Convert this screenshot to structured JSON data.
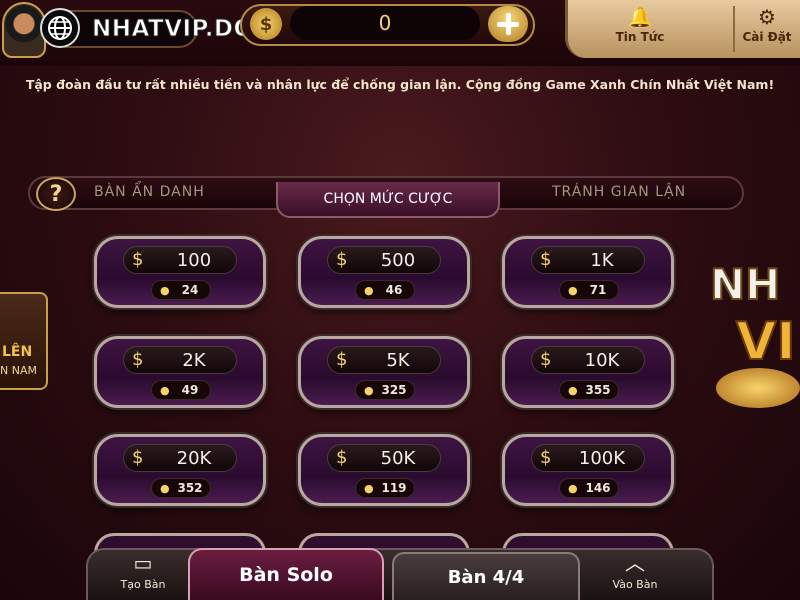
{
  "header": {
    "watermark": "NHATVIP.DOG",
    "balance": "0",
    "news_label": "Tin Tức",
    "settings_label": "Cài Đặt"
  },
  "marquee": "Tập đoàn đầu tư rất nhiều tiền và nhân lực để chống gian lận. Cộng đồng Game Xanh Chín Nhất Việt Nam!",
  "tabs": {
    "help": "?",
    "anonymous": "BÀN ẨN DANH",
    "choose_bet": "CHỌN MỨC CƯỢC",
    "anti_cheat": "TRÁNH GIAN LẬN"
  },
  "bets": [
    {
      "amount": "100",
      "players": "24"
    },
    {
      "amount": "500",
      "players": "46"
    },
    {
      "amount": "1K",
      "players": "71"
    },
    {
      "amount": "2K",
      "players": "49"
    },
    {
      "amount": "5K",
      "players": "325"
    },
    {
      "amount": "10K",
      "players": "355"
    },
    {
      "amount": "20K",
      "players": "352"
    },
    {
      "amount": "50K",
      "players": "119"
    },
    {
      "amount": "100K",
      "players": "146"
    }
  ],
  "side": {
    "left_line1": "LÊN",
    "left_line2": "N NAM",
    "right_line1": "NH",
    "right_line2": "VI"
  },
  "bottom": {
    "create_table": "Tạo Bàn",
    "solo": "Bàn Solo",
    "four": "Bàn 4/4",
    "join_table": "Vào Bàn"
  },
  "colors": {
    "gold": "#f6d36a",
    "background": "#2e0d12",
    "card": "#3e1442"
  }
}
